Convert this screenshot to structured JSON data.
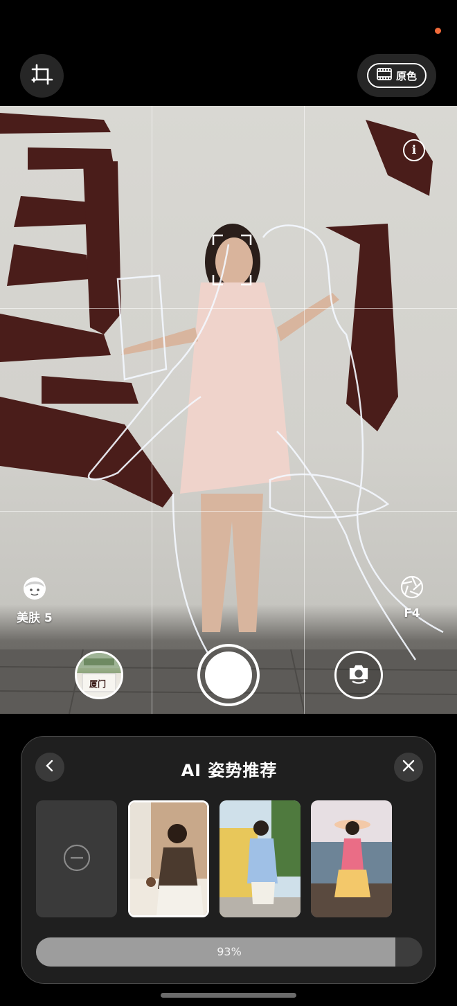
{
  "status": {
    "indicator_color": "#f26b3a"
  },
  "top_bar": {
    "crop_icon": "ai-crop-icon",
    "color_mode_label": "原色",
    "color_mode_icon": "film-icon"
  },
  "viewfinder": {
    "info_icon": "info-icon",
    "info_glyph": "i",
    "focus_icon": "face-focus-icon",
    "beauty": {
      "label": "美肤 5",
      "icon": "face-beauty-icon"
    },
    "aperture": {
      "label": "F4",
      "icon": "aperture-icon"
    },
    "gallery_thumb_text": "厦门",
    "calligraphy_left": "廈",
    "calligraphy_right": "门"
  },
  "controls": {
    "shutter_icon": "shutter-button",
    "flip_icon": "camera-flip-icon"
  },
  "pose_panel": {
    "title": "AI 姿势推荐",
    "back_icon": "chevron-left-icon",
    "close_icon": "close-icon",
    "none_icon": "minus-circle-icon",
    "poses": [
      {
        "name": "pose-cafe",
        "selected": true
      },
      {
        "name": "pose-street",
        "selected": false
      },
      {
        "name": "pose-seaside",
        "selected": false
      }
    ],
    "progress_percent": 93,
    "progress_label": "93%"
  },
  "colors": {
    "panel_bg": "#1f1f1f",
    "accent": "#ffffff"
  }
}
